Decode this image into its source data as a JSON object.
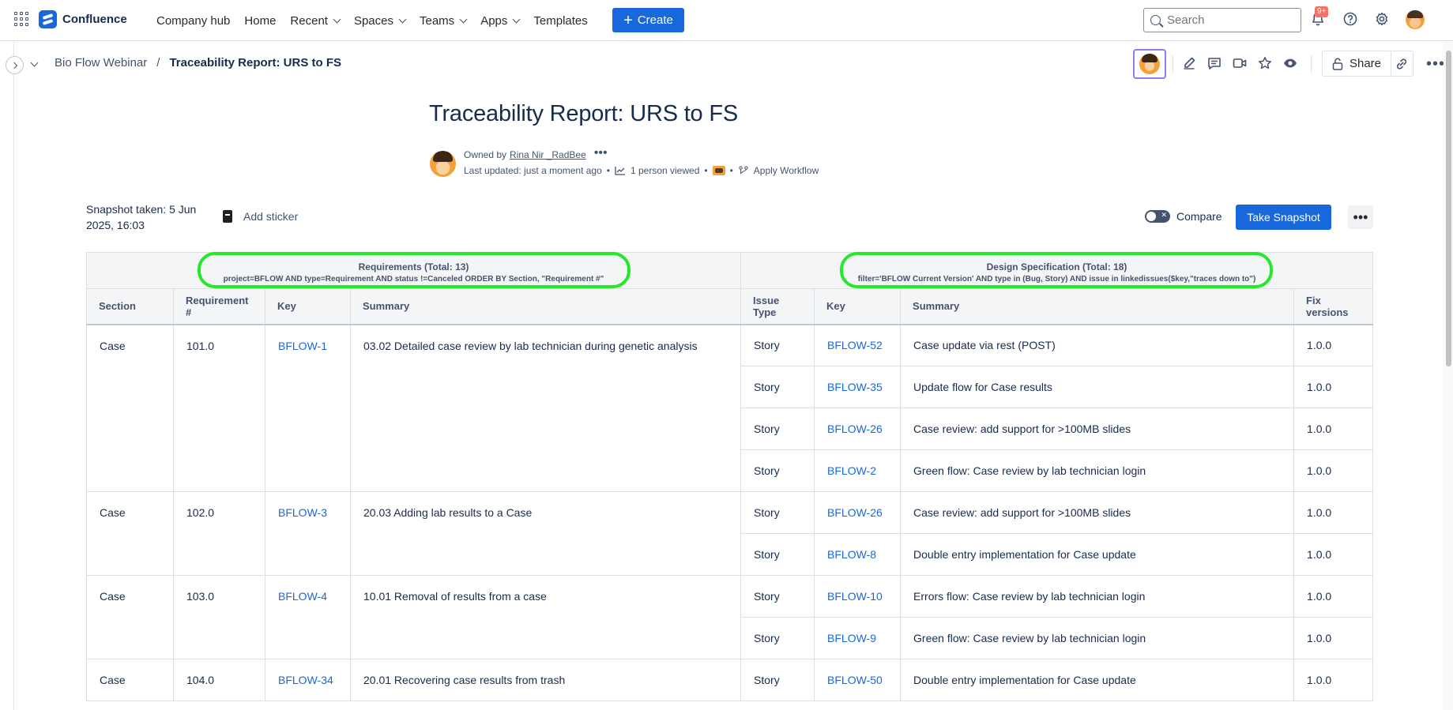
{
  "topnav": {
    "logo_text": "Confluence",
    "items": [
      {
        "label": "Company hub",
        "dropdown": false
      },
      {
        "label": "Home",
        "dropdown": false
      },
      {
        "label": "Recent",
        "dropdown": true
      },
      {
        "label": "Spaces",
        "dropdown": true
      },
      {
        "label": "Teams",
        "dropdown": true
      },
      {
        "label": "Apps",
        "dropdown": true
      },
      {
        "label": "Templates",
        "dropdown": false
      }
    ],
    "create_label": "Create",
    "search_placeholder": "Search",
    "notifications_badge": "9+",
    "accent_color": "#1868db"
  },
  "breadcrumb": {
    "space": "Bio Flow Webinar",
    "separator": "/",
    "page": "Traceability Report: URS to FS"
  },
  "page_actions": {
    "share_label": "Share",
    "icons": [
      "edit-icon",
      "comment-icon",
      "video-icon",
      "star-icon",
      "watch-icon",
      "lock-icon",
      "link-icon",
      "more-icon"
    ]
  },
  "page": {
    "title": "Traceability Report: URS to FS",
    "owned_by_prefix": "Owned by",
    "owner": "Rina Nir _RadBee",
    "last_updated": "Last updated: just a moment ago",
    "viewed": "1 person viewed",
    "workflow": "Apply Workflow"
  },
  "snapshot_bar": {
    "snapshot_text": "Snapshot taken: 5 Jun 2025, 16:03",
    "add_sticker": "Add sticker",
    "compare": "Compare",
    "take_snapshot": "Take Snapshot"
  },
  "report": {
    "requirements_group": {
      "title": "Requirements (Total: 13)",
      "query": "project=BFLOW AND type=Requirement AND status !=Canceled ORDER BY Section, \"Requirement #\""
    },
    "design_group": {
      "title": "Design Specification (Total: 18)",
      "query": "filter='BFLOW Current Version' AND type in (Bug, Story) AND issue in linkedissues($key,\"traces down to\")"
    },
    "columns": [
      "Section",
      "Requirement #",
      "Key",
      "Summary",
      "Issue Type",
      "Key",
      "Summary",
      "Fix versions"
    ],
    "rows": [
      {
        "section": "Case",
        "req_num": "101.0",
        "key": "BFLOW-1",
        "summary": "03.02 Detailed case review by lab technician during genetic analysis",
        "specs": [
          {
            "type": "Story",
            "key": "BFLOW-52",
            "summary": "Case update via rest (POST)",
            "fix": "1.0.0"
          },
          {
            "type": "Story",
            "key": "BFLOW-35",
            "summary": "Update flow for Case results",
            "fix": "1.0.0"
          },
          {
            "type": "Story",
            "key": "BFLOW-26",
            "summary": "Case review: add support for >100MB slides",
            "fix": "1.0.0"
          },
          {
            "type": "Story",
            "key": "BFLOW-2",
            "summary": "Green flow: Case review by lab technician login",
            "fix": "1.0.0"
          }
        ]
      },
      {
        "section": "Case",
        "req_num": "102.0",
        "key": "BFLOW-3",
        "summary": "20.03 Adding lab results to a Case",
        "specs": [
          {
            "type": "Story",
            "key": "BFLOW-26",
            "summary": "Case review: add support for >100MB slides",
            "fix": "1.0.0"
          },
          {
            "type": "Story",
            "key": "BFLOW-8",
            "summary": "Double entry implementation for Case update",
            "fix": "1.0.0"
          }
        ]
      },
      {
        "section": "Case",
        "req_num": "103.0",
        "key": "BFLOW-4",
        "summary": "10.01 Removal of results from a case",
        "specs": [
          {
            "type": "Story",
            "key": "BFLOW-10",
            "summary": "Errors flow: Case review by lab technician login",
            "fix": "1.0.0"
          },
          {
            "type": "Story",
            "key": "BFLOW-9",
            "summary": "Green flow: Case review by lab technician login",
            "fix": "1.0.0"
          }
        ]
      },
      {
        "section": "Case",
        "req_num": "104.0",
        "key": "BFLOW-34",
        "summary": "20.01 Recovering case results from trash",
        "specs": [
          {
            "type": "Story",
            "key": "BFLOW-50",
            "summary": "Double entry implementation for Case update",
            "fix": "1.0.0"
          }
        ]
      }
    ]
  }
}
